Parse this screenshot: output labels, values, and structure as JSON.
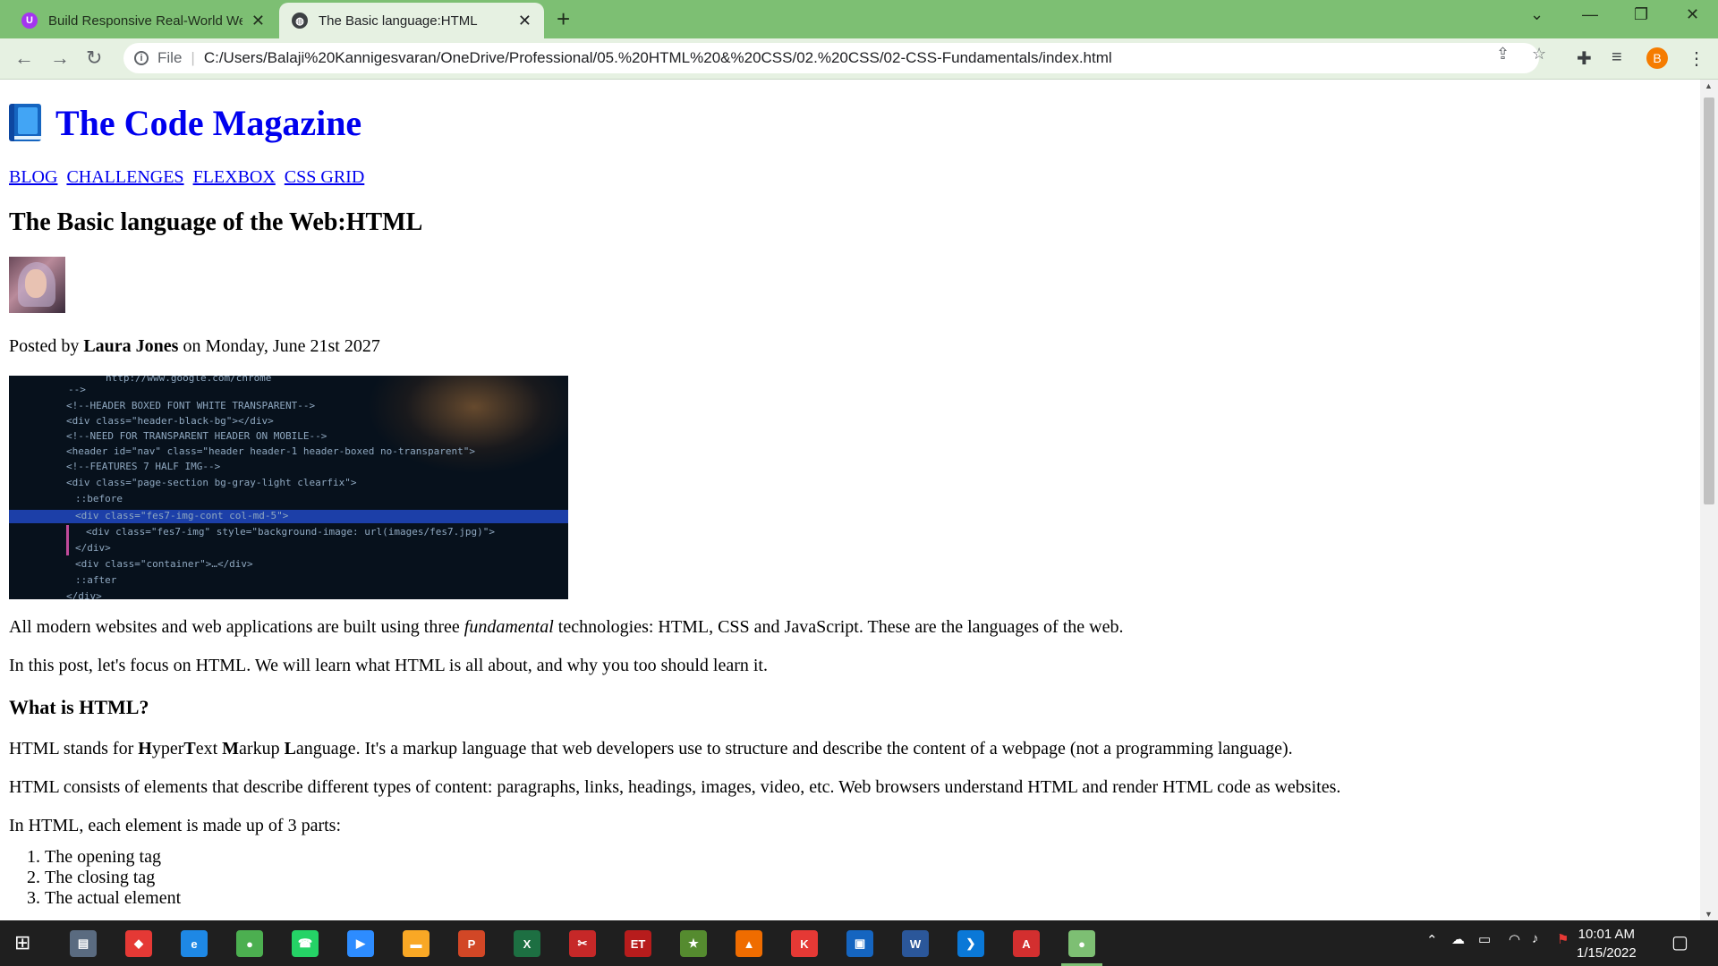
{
  "browser": {
    "tabs": [
      {
        "title": "Build Responsive Real-World Wel",
        "favicon": "udemy-icon",
        "active": false
      },
      {
        "title": "The Basic language:HTML",
        "favicon": "globe-icon",
        "active": true
      }
    ],
    "new_tab_label": "+",
    "address": {
      "scheme_label": "File",
      "url": "C:/Users/Balaji%20Kannigesvaran/OneDrive/Professional/05.%20HTML%20&%20CSS/02.%20CSS/02-CSS-Fundamentals/index.html"
    },
    "profile_initial": "B",
    "colors": {
      "frame": "#7dbf73",
      "toolbar": "#e6f1e2"
    }
  },
  "page": {
    "site_title": "The Code Magazine",
    "nav": [
      "BLOG",
      "CHALLENGES",
      "FLEXBOX",
      "CSS GRID"
    ],
    "post_title": "The Basic language of the Web:HTML",
    "meta": {
      "prefix": "Posted by",
      "author": "Laura Jones",
      "suffix": "on Monday, June 21st 2027"
    },
    "code_image_lines": [
      "http://www.google.com/chrome",
      "-->",
      "<!--HEADER BOXED FONT WHITE TRANSPARENT-->",
      "<div class=\"header-black-bg\"></div>",
      "<!--NEED FOR TRANSPARENT HEADER ON MOBILE-->",
      "<header id=\"nav\" class=\"header header-1 header-boxed no-transparent\">",
      "<!--FEATURES 7 HALF IMG-->",
      "<div class=\"page-section bg-gray-light clearfix\">",
      "::before",
      "<div class=\"fes7-img-cont col-md-5\">",
      "<div class=\"fes7-img\" style=\"background-image: url(images/fes7.jpg)\">",
      "</div>",
      "<div class=\"container\">…</div>",
      "::after",
      "</div>"
    ],
    "intro": {
      "before": "All modern websites and web applications are built using three ",
      "emphasis": "fundamental",
      "after": " technologies: HTML, CSS and JavaScript. These are the languages of the web."
    },
    "intro2": "In this post, let's focus on HTML. We will learn what HTML is all about, and why you too should learn it.",
    "section_heading": "What is HTML?",
    "html_def": {
      "lead": "HTML stands for ",
      "acronym": [
        {
          "initial": "H",
          "rest": "yper"
        },
        {
          "initial": "T",
          "rest": "ext "
        },
        {
          "initial": "M",
          "rest": "arkup "
        },
        {
          "initial": "L",
          "rest": "anguage"
        }
      ],
      "tail": ". It's a markup language that web developers use to structure and describe the content of a webpage (not a programming language)."
    },
    "elements_para": "HTML consists of elements that describe different types of content: paragraphs, links, headings, images, video, etc. Web browsers understand HTML and render HTML code as websites.",
    "parts_intro": "In HTML, each element is made up of 3 parts:",
    "parts": [
      "The opening tag",
      "The closing tag",
      "The actual element"
    ]
  },
  "taskbar": {
    "apps": [
      {
        "name": "file-explorer-alt-icon",
        "glyph": "▤",
        "color": "#5a6b80"
      },
      {
        "name": "anydesk-icon",
        "glyph": "◆",
        "color": "#e53935"
      },
      {
        "name": "edge-icon",
        "glyph": "e",
        "color": "#1e88e5"
      },
      {
        "name": "chrome-icon",
        "glyph": "●",
        "color": "#4caf50"
      },
      {
        "name": "whatsapp-icon",
        "glyph": "☎",
        "color": "#25d366"
      },
      {
        "name": "zoom-icon",
        "glyph": "▶",
        "color": "#2d8cff"
      },
      {
        "name": "file-explorer-icon",
        "glyph": "▬",
        "color": "#f9a825"
      },
      {
        "name": "powerpoint-icon",
        "glyph": "P",
        "color": "#d24726"
      },
      {
        "name": "excel-icon",
        "glyph": "X",
        "color": "#1d6f42"
      },
      {
        "name": "snipping-tool-icon",
        "glyph": "✂",
        "color": "#c62828"
      },
      {
        "name": "et-app-icon",
        "glyph": "ET",
        "color": "#b71c1c"
      },
      {
        "name": "tally-icon",
        "glyph": "★",
        "color": "#558b2f"
      },
      {
        "name": "vlc-icon",
        "glyph": "▲",
        "color": "#ef6c00"
      },
      {
        "name": "kingsoft-icon",
        "glyph": "K",
        "color": "#e53935"
      },
      {
        "name": "remote-desktop-icon",
        "glyph": "▣",
        "color": "#1565c0"
      },
      {
        "name": "word-icon",
        "glyph": "W",
        "color": "#2b579a"
      },
      {
        "name": "vscode-icon",
        "glyph": "❯",
        "color": "#0a78d7"
      },
      {
        "name": "acrobat-icon",
        "glyph": "A",
        "color": "#d32f2f"
      },
      {
        "name": "chrome-profile-icon",
        "glyph": "●",
        "color": "#7dbf73"
      }
    ],
    "time": "10:01 AM",
    "date": "1/15/2022"
  }
}
